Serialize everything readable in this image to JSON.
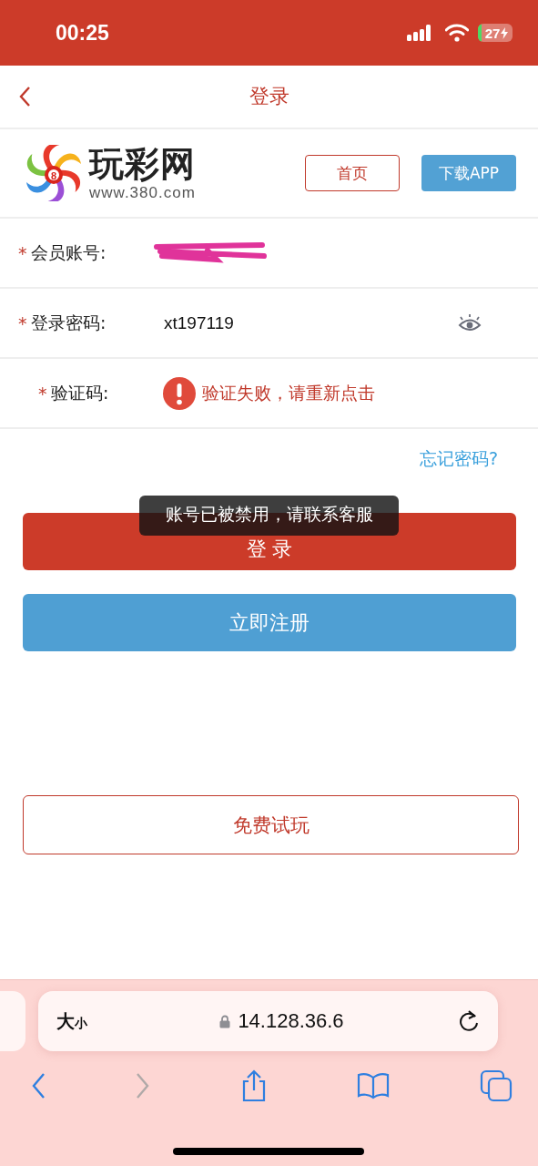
{
  "status_bar": {
    "time": "00:25",
    "battery": "27"
  },
  "header": {
    "title": "登录"
  },
  "brand": {
    "name": "玩彩网",
    "domain": "www.380.com",
    "ball": "8",
    "buttons": [
      {
        "label": "首页",
        "kind": "outline"
      },
      {
        "label": "下载APP",
        "kind": "filled"
      }
    ]
  },
  "form": {
    "rows": [
      {
        "marker": "*",
        "label": "会员账号:",
        "kind": "text",
        "redacted": true
      },
      {
        "marker": "*",
        "label": "登录密码:",
        "kind": "password",
        "value": "xt197119"
      },
      {
        "marker": "*",
        "label": "验证码:",
        "kind": "captcha",
        "error": "验证失败，请重新点击"
      }
    ],
    "forgot_link": "忘记密码?"
  },
  "buttons": [
    {
      "label": "登 录",
      "kind": "primary"
    },
    {
      "label": "立即注册",
      "kind": "secondary"
    }
  ],
  "trial_button": "免费试玩",
  "toast": "账号已被禁用，请联系客服",
  "browser": {
    "text_size": [
      "大",
      "小"
    ],
    "address": "14.128.36.6",
    "back_enabled": true,
    "forward_enabled": false
  }
}
